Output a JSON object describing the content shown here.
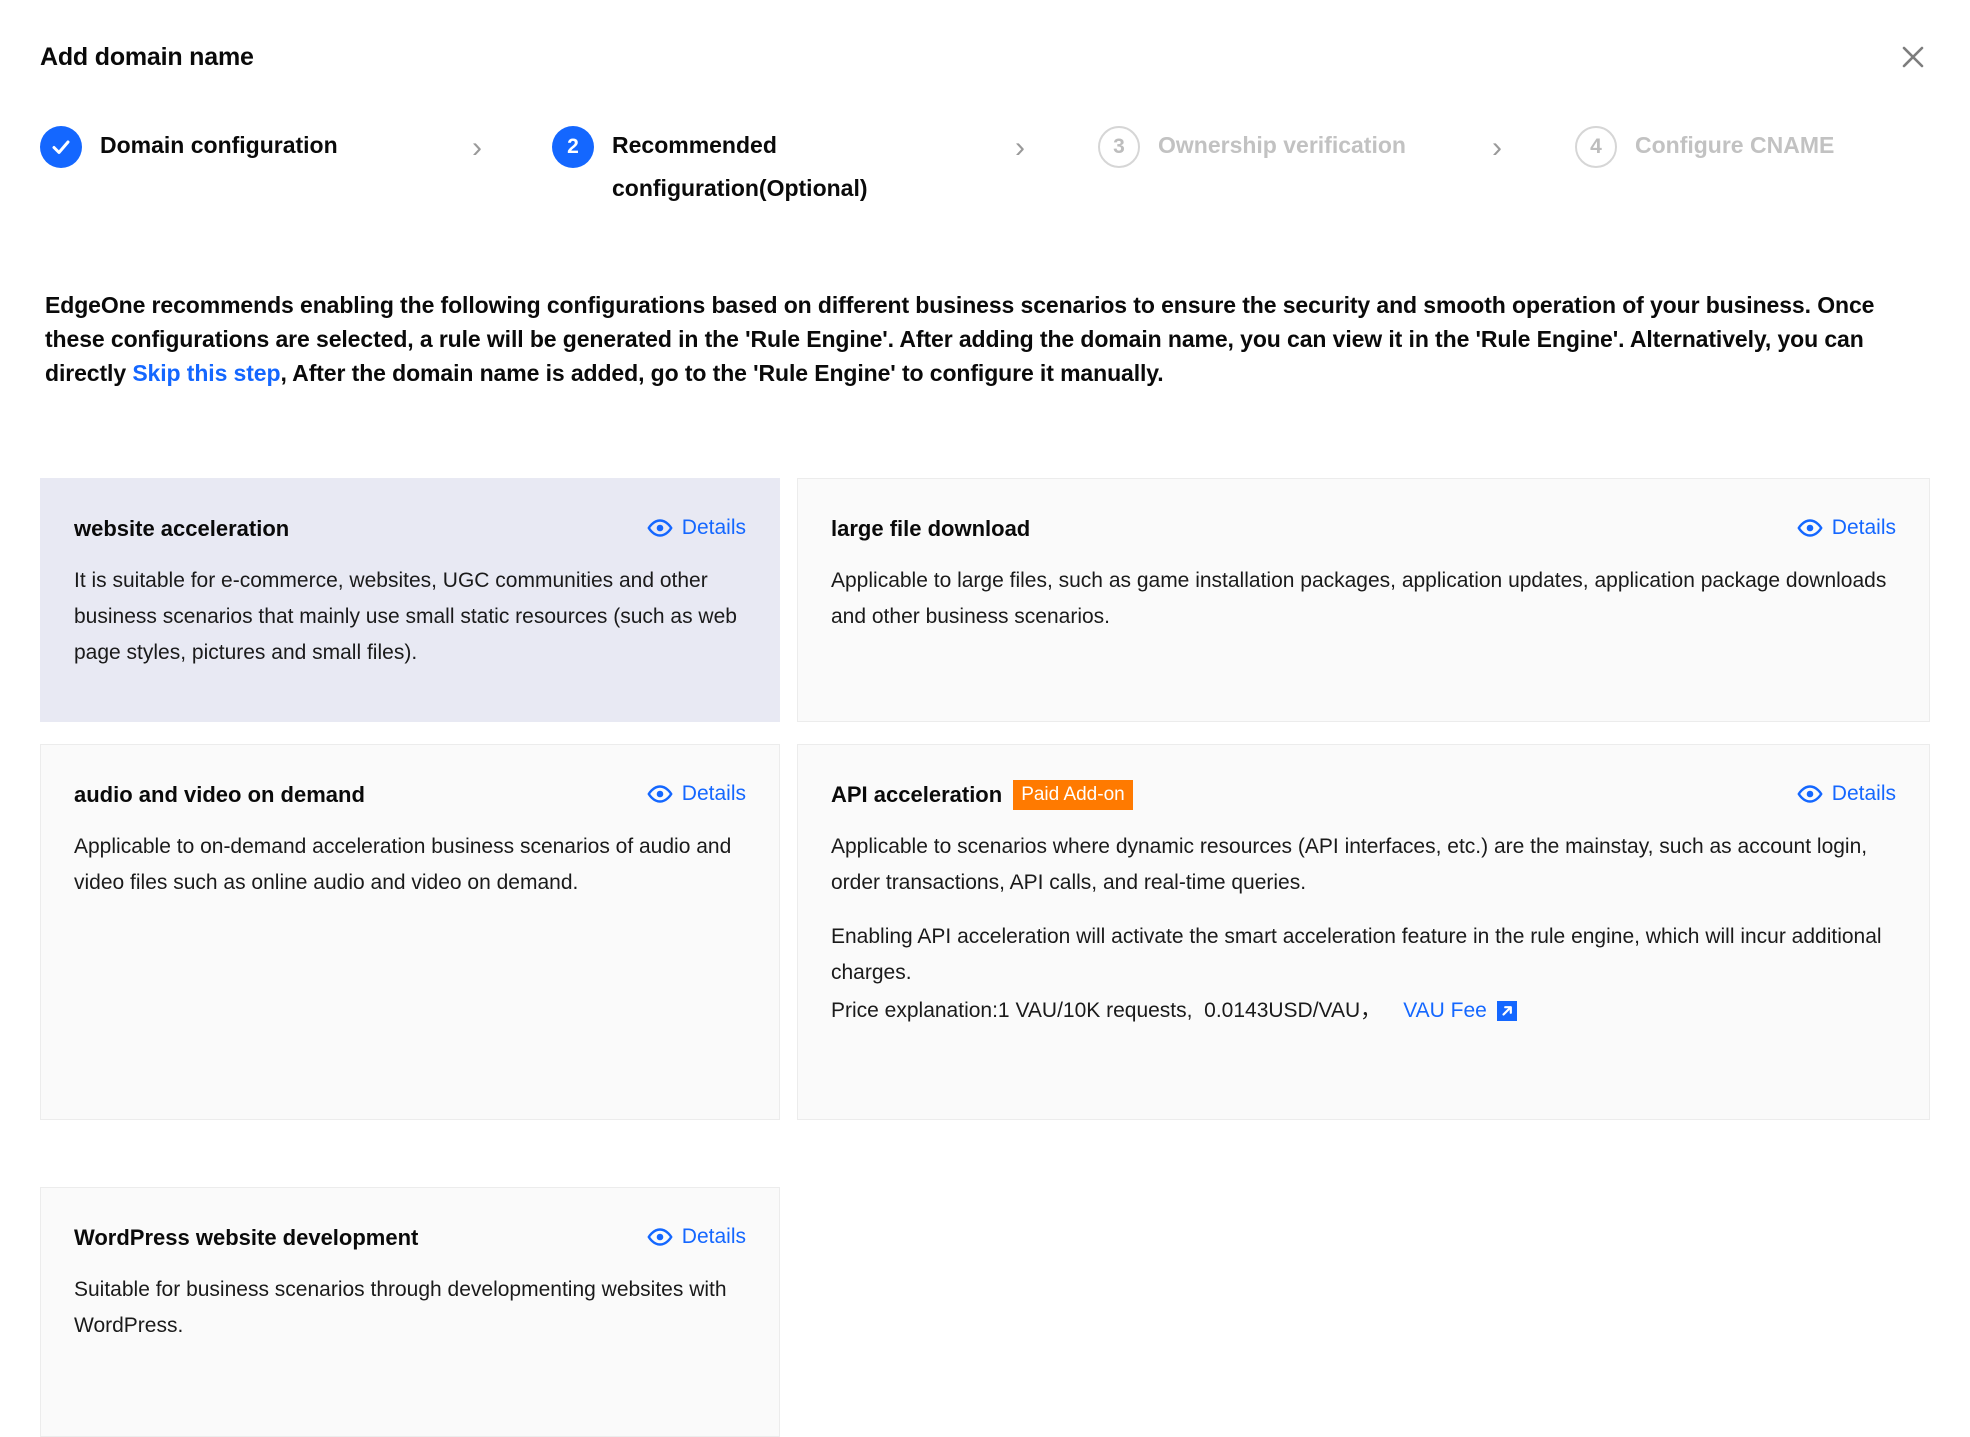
{
  "header": {
    "title": "Add domain name",
    "close_icon": "close-icon"
  },
  "stepper": {
    "steps": [
      {
        "number": "1",
        "state": "done",
        "marker": "✓",
        "label": "Domain configuration"
      },
      {
        "number": "2",
        "state": "active",
        "marker": "2",
        "label": "Recommended configuration(Optional)"
      },
      {
        "number": "3",
        "state": "todo",
        "marker": "3",
        "label": "Ownership verification"
      },
      {
        "number": "4",
        "state": "todo",
        "marker": "4",
        "label": "Configure CNAME"
      }
    ],
    "separator": "›"
  },
  "intro": {
    "part1": "EdgeOne recommends enabling the following configurations based on different business scenarios to ensure the security and smooth operation of your business. Once these configurations are selected, a rule will be generated in the 'Rule Engine'. After adding the domain name, you can view it in the 'Rule Engine'. Alternatively, you can directly ",
    "link": "Skip this step",
    "part2": ", After the domain name is added, go to the 'Rule Engine' to configure it manually."
  },
  "common": {
    "details_label": "Details",
    "details_icon": "eye-icon",
    "external_link_icon": "external-link-icon"
  },
  "colors": {
    "accent": "#1467ff",
    "badge_bg": "#ff7a00",
    "selected_card_bg": "#e8e9f3",
    "card_bg": "#fafafa",
    "card_border": "#ececec",
    "muted_text": "#c2c2c2"
  },
  "cards": {
    "website": {
      "title": "website acceleration",
      "selected": true,
      "desc": "It is suitable for e-commerce, websites, UGC communities and other business scenarios that mainly use small static resources (such as web page styles, pictures and small files)."
    },
    "largefile": {
      "title": "large file download",
      "selected": false,
      "desc": "Applicable to large files, such as game installation packages, application updates, application package downloads and other business scenarios."
    },
    "av": {
      "title": "audio and video on demand",
      "selected": false,
      "desc": "Applicable to on-demand acceleration business scenarios of audio and video files such as online audio and video on demand."
    },
    "api": {
      "title": "API acceleration",
      "badge": "Paid Add-on",
      "selected": false,
      "desc1": "Applicable to scenarios where dynamic resources (API interfaces, etc.) are the mainstay, such as account login, order transactions, API calls, and real-time queries.",
      "desc2": "Enabling API acceleration will activate the smart acceleration feature in the rule engine, which will incur additional charges.",
      "price_text": "Price explanation:1 VAU/10K requests,  0.0143USD/VAU，",
      "price_link": "VAU Fee"
    },
    "wordpress": {
      "title": "WordPress website development",
      "selected": false,
      "desc": "Suitable for business scenarios through developmenting websites with WordPress."
    }
  }
}
